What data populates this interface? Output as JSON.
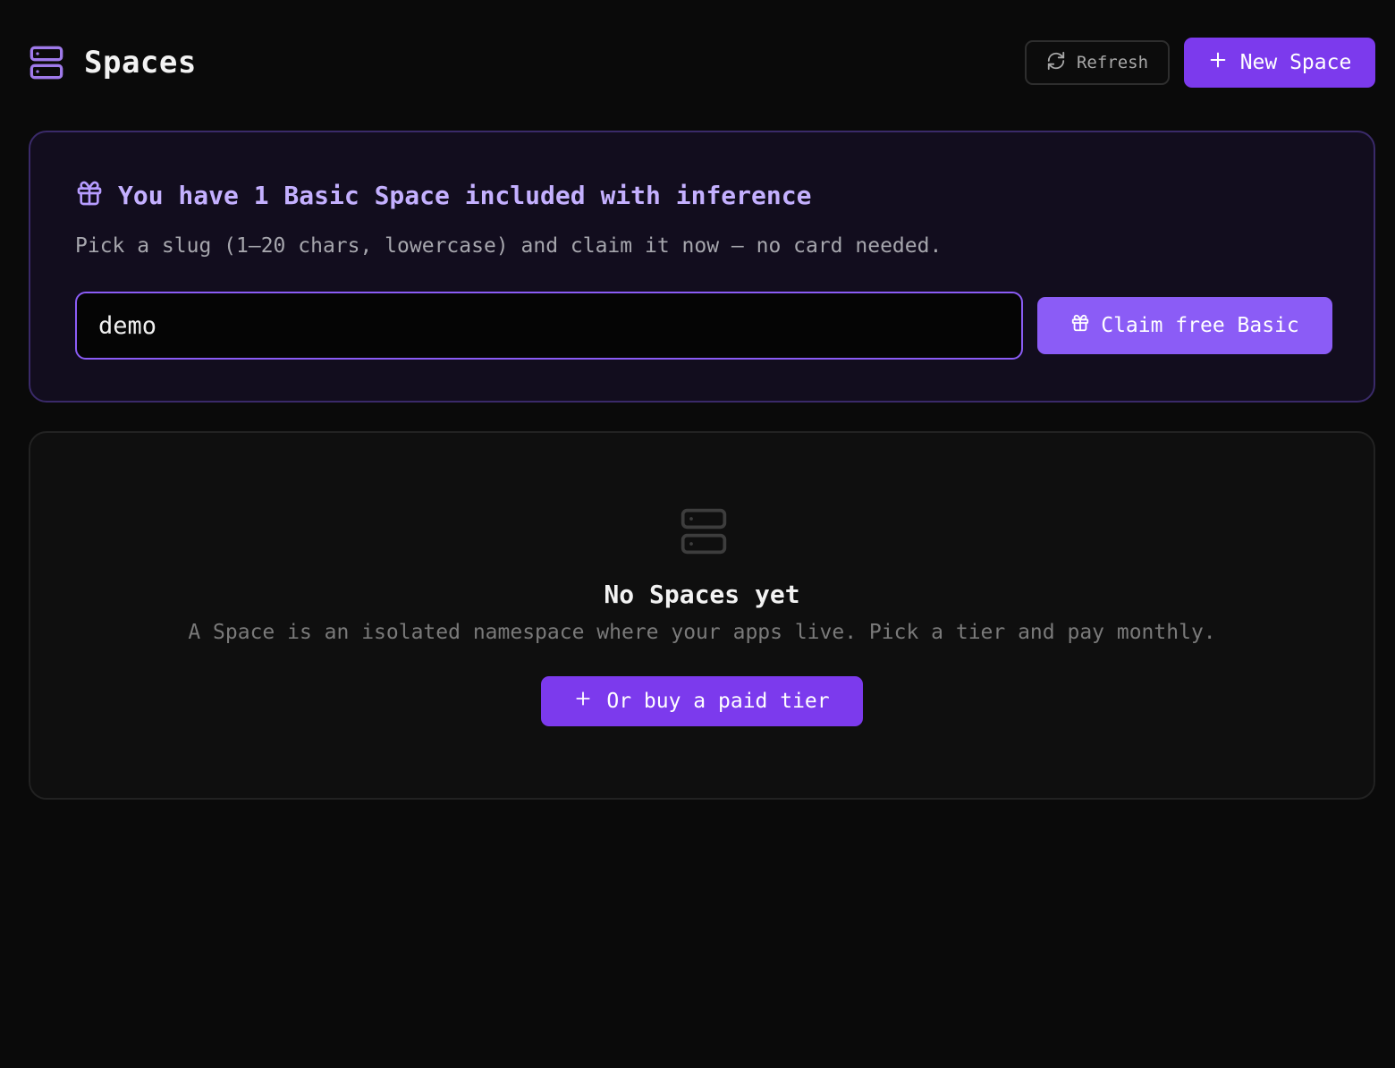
{
  "header": {
    "title": "Spaces",
    "title_icon": "server-icon",
    "refresh_label": "Refresh",
    "refresh_icon": "refresh-icon",
    "new_space_label": "New Space",
    "new_space_icon": "plus-icon"
  },
  "promo": {
    "icon": "gift-icon",
    "title": "You have 1 Basic Space included with inference",
    "subtitle": "Pick a slug (1–20 chars, lowercase) and claim it now — no card needed.",
    "slug_value": "demo",
    "claim_label": "Claim free Basic",
    "claim_icon": "gift-icon"
  },
  "empty_state": {
    "icon": "server-icon",
    "title": "No Spaces yet",
    "subtitle": "A Space is an isolated namespace where your apps live. Pick a tier and pay monthly.",
    "cta_label": "Or buy a paid tier",
    "cta_icon": "plus-icon"
  },
  "colors": {
    "accent": "#7c3aed",
    "accent_light": "#8b5cf6",
    "promo_title": "#c4b0ff",
    "background": "#0a0a0a"
  }
}
